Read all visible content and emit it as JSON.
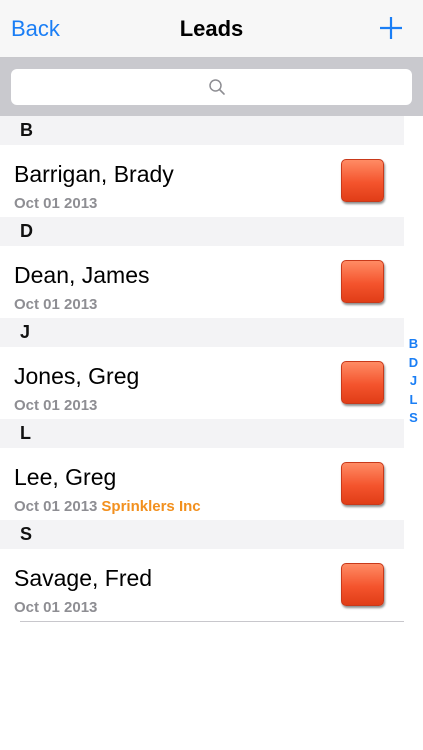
{
  "nav": {
    "back_label": "Back",
    "title": "Leads",
    "add_icon": "plus-icon"
  },
  "search": {
    "placeholder": "",
    "icon": "search-icon"
  },
  "sections": [
    {
      "letter": "B",
      "rows": [
        {
          "name": "Barrigan, Brady",
          "date": "Oct 01 2013",
          "company": ""
        }
      ]
    },
    {
      "letter": "D",
      "rows": [
        {
          "name": "Dean, James",
          "date": "Oct 01 2013",
          "company": ""
        }
      ]
    },
    {
      "letter": "J",
      "rows": [
        {
          "name": "Jones, Greg",
          "date": "Oct 01 2013",
          "company": ""
        }
      ]
    },
    {
      "letter": "L",
      "rows": [
        {
          "name": "Lee, Greg",
          "date": "Oct 01 2013",
          "company": "Sprinklers Inc"
        }
      ]
    },
    {
      "letter": "S",
      "rows": [
        {
          "name": "Savage, Fred",
          "date": "Oct 01 2013",
          "company": ""
        }
      ]
    }
  ],
  "index_letters": [
    "B",
    "D",
    "J",
    "L",
    "S"
  ],
  "colors": {
    "accent": "#1a7ef5",
    "company_text": "#f2901e",
    "status_box": "#f4542d"
  }
}
